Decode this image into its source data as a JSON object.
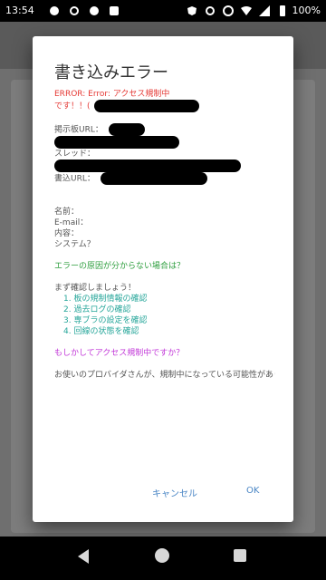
{
  "status": {
    "time": "13:54",
    "battery": "100%"
  },
  "dialog": {
    "title": "書き込みエラー",
    "error_line1": "ERROR: Error: アクセス規制中",
    "error_line2": "です！！(",
    "board_label": "掲示板URL：",
    "subject_label": "スレッド：",
    "url_label": "書込URL：",
    "name_label": "名前：",
    "email_label": "E-mail：",
    "body_label": "内容：",
    "question": "システム？",
    "hint1": "エラーの原因が分からない場合は？",
    "check_heading": "まず確認しましょう！",
    "checks": [
      "1. 板の規制情報の確認",
      "2. 過去ログの確認",
      "3. 専ブラの設定を確認",
      "4. 回線の状態を確認"
    ],
    "hint2": "もしかしてアクセス規制中ですか？",
    "footer_text": "お使いのプロバイダさんが、規制中になっている可能性がありま",
    "cancel_label": "キャンセル",
    "ok_label": "OK"
  }
}
